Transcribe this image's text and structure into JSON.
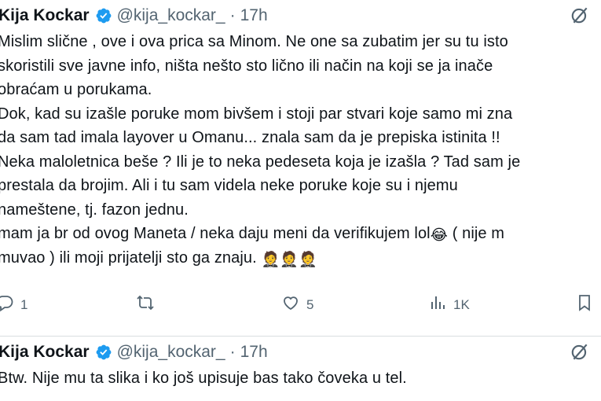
{
  "tweets": [
    {
      "author_name": "Kija Kockar",
      "handle": "@kija_kockar_",
      "separator": "·",
      "time": "17h",
      "lines": [
        "Mislim slične , ove i ova prica sa Minom. Ne one sa zubatim jer su tu isto",
        "skoristili sve javne info, ništa nešto sto lično ili način na koji se ja inače",
        "obraćam u porukama.",
        "Dok, kad su izašle poruke mom bivšem i stoji par stvari koje samo mi zna",
        "da sam tad imala layover u Omanu... znala sam da je prepiska istinita !!",
        "Neka maloletnica beše ? Ili je to neka pedeseta koja je izašla ? Tad sam je",
        "prestala da brojim. Ali i tu sam videla neke poruke koje su i njemu",
        "nameštene, tj. fazon jednu.",
        "mam ja br od ovog Maneta / neka daju meni da verifikujem lol",
        "muvao ) ili moji prijatelji sto ga znaju."
      ],
      "line9_emoji": "😂",
      "line9_tail": " ( nije m",
      "line10_emojis": [
        "🤵",
        "🤵",
        "🤵"
      ],
      "stats": {
        "replies": "1",
        "retweets": "",
        "likes": "5",
        "views": "1K"
      }
    },
    {
      "author_name": "Kija Kockar",
      "handle": "@kija_kockar_",
      "separator": "·",
      "time": "17h",
      "lines": [
        "Btw. Nije mu ta slika i ko još upisuje bas tako čoveka u tel."
      ]
    }
  ],
  "colors": {
    "text": "#0f1419",
    "secondary": "#536471",
    "verified": "#1d9bf0",
    "divider": "#d9dde0"
  },
  "icons": [
    "verified-badge-icon",
    "grok-icon",
    "reply-icon",
    "retweet-icon",
    "like-icon",
    "views-icon",
    "bookmark-icon"
  ]
}
